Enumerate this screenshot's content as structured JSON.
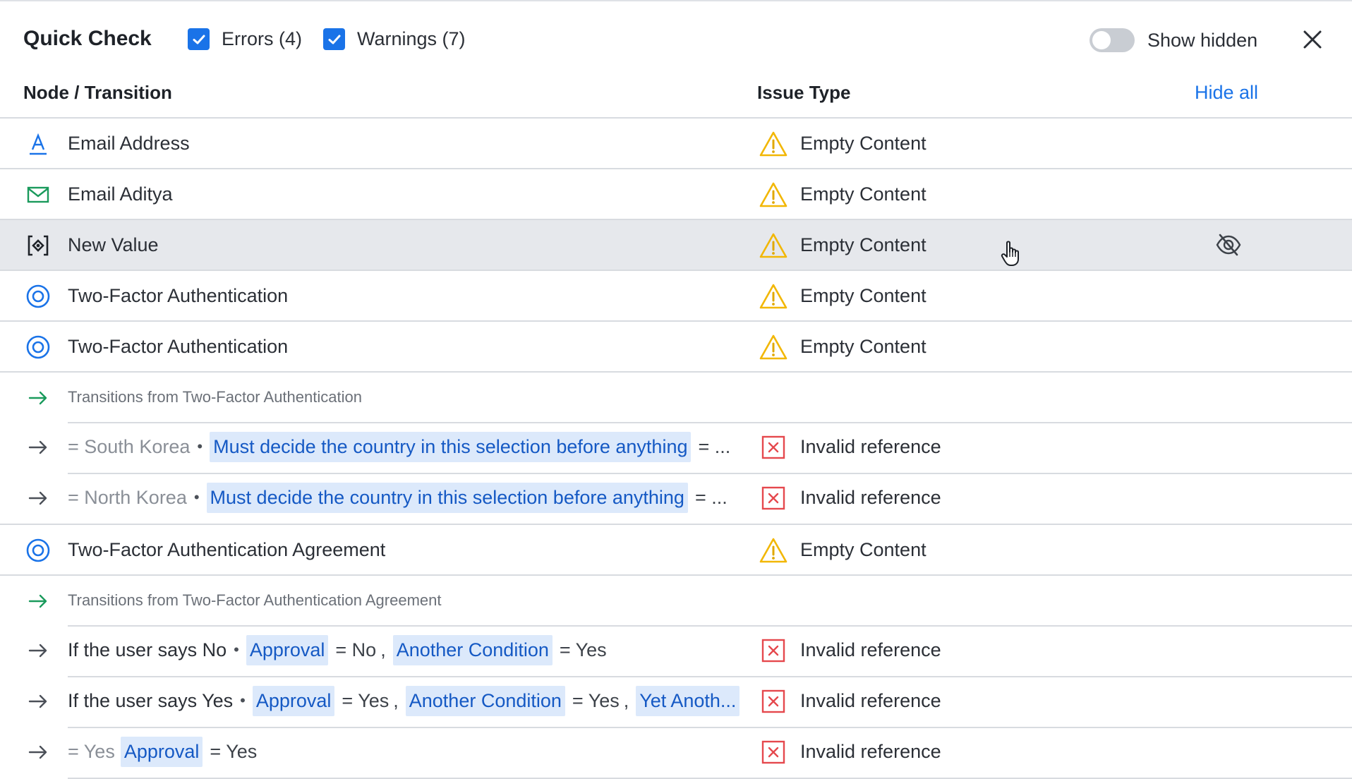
{
  "header": {
    "title": "Quick Check",
    "filters": [
      {
        "label": "Errors (4)",
        "checked": true
      },
      {
        "label": "Warnings (7)",
        "checked": true
      }
    ],
    "show_hidden": {
      "label": "Show hidden",
      "on": false
    },
    "close_icon": "close-icon"
  },
  "columns": {
    "node": "Node / Transition",
    "issue": "Issue Type",
    "hide_all": "Hide all"
  },
  "colors": {
    "accent": "#1a73e8",
    "warning": "#f2b705",
    "error": "#e5484d",
    "transition_green": "#1a9a5c",
    "chip_bg": "#dce9fb",
    "hover_row": "#e6e8ec"
  },
  "rows": [
    {
      "icon": "text-input-icon",
      "name": "Email Address",
      "issue_icon": "warning-icon",
      "issue": "Empty Content"
    },
    {
      "icon": "email-icon",
      "name": "Email Aditya",
      "issue_icon": "warning-icon",
      "issue": "Empty Content"
    },
    {
      "icon": "variable-icon",
      "name": "New Value",
      "issue_icon": "warning-icon",
      "issue": "Empty Content",
      "hover": true,
      "action_icon": "hide-eye-icon"
    },
    {
      "icon": "target-icon",
      "name": "Two-Factor Authentication",
      "issue_icon": "warning-icon",
      "issue": "Empty Content"
    },
    {
      "icon": "target-icon",
      "name": "Two-Factor Authentication",
      "issue_icon": "warning-icon",
      "issue": "Empty Content"
    },
    {
      "icon": "transition-arrow-icon",
      "group": "Transitions from Two-Factor Authentication"
    },
    {
      "icon": "arrow-icon",
      "cond": {
        "prefix": "= South Korea",
        "sep": "•",
        "chip1": "Must decide the country in this selection before anything",
        "after1": "= ..."
      },
      "issue_icon": "error-icon",
      "issue": "Invalid reference"
    },
    {
      "icon": "arrow-icon",
      "cond": {
        "prefix": "= North Korea",
        "sep": "•",
        "chip1": "Must decide the country in this selection before anything",
        "after1": "= ..."
      },
      "issue_icon": "error-icon",
      "issue": "Invalid reference"
    },
    {
      "icon": "target-icon",
      "name": "Two-Factor Authentication Agreement",
      "issue_icon": "warning-icon",
      "issue": "Empty Content"
    },
    {
      "icon": "transition-arrow-icon",
      "group": "Transitions from Two-Factor Authentication Agreement"
    },
    {
      "icon": "arrow-icon",
      "cond": {
        "prefix": "If the user says No",
        "sep": "•",
        "chip1": "Approval",
        "after1": "= No",
        "comma1": ",",
        "chip2": "Another Condition",
        "after2": "= Yes"
      },
      "issue_icon": "error-icon",
      "issue": "Invalid reference"
    },
    {
      "icon": "arrow-icon",
      "cond": {
        "prefix": "If the user says Yes",
        "sep": "•",
        "chip1": "Approval",
        "after1": "= Yes",
        "comma1": ",",
        "chip2": "Another Condition",
        "after2": "= Yes",
        "comma2": ",",
        "chip3": "Yet Anoth..."
      },
      "issue_icon": "error-icon",
      "issue": "Invalid reference"
    },
    {
      "icon": "arrow-icon",
      "cond": {
        "prefix": "= Yes",
        "chip1": "Approval",
        "after1": "= Yes"
      },
      "issue_icon": "error-icon",
      "issue": "Invalid reference"
    }
  ]
}
